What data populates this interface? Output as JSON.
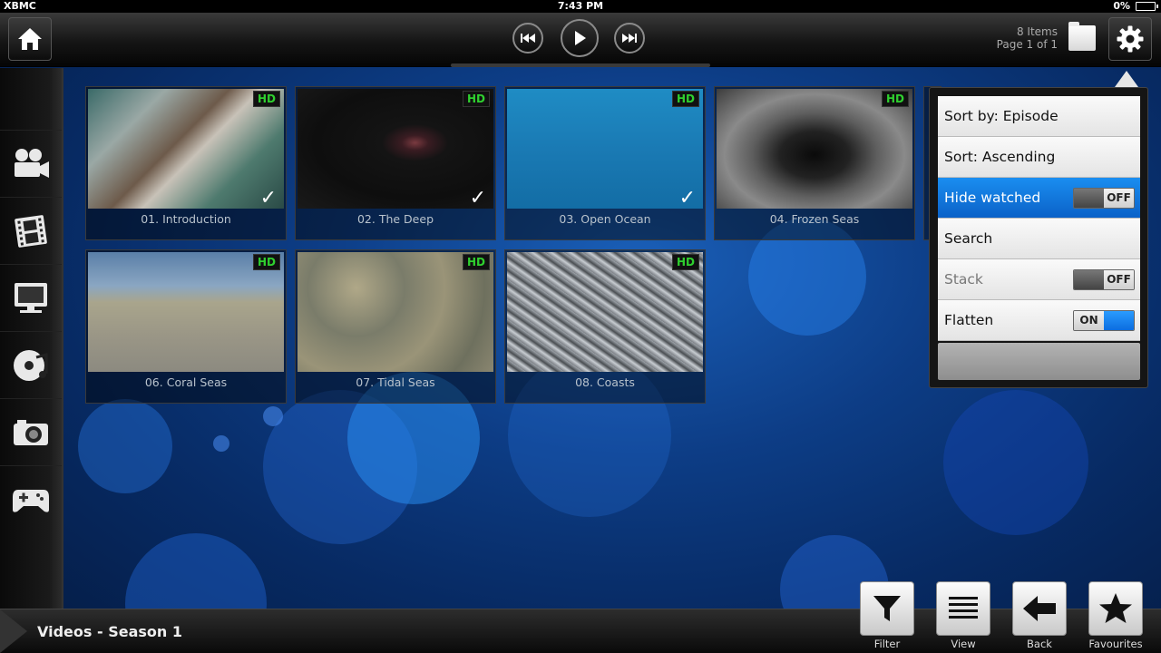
{
  "status_bar": {
    "app_name": "XBMC",
    "time": "7:43 PM",
    "battery": "0%"
  },
  "header": {
    "items_count": "8 Items",
    "page_info": "Page 1 of 1"
  },
  "sidebar": {
    "items": [
      {
        "name": "movies",
        "icon": "film-camera-icon"
      },
      {
        "name": "tv-shows",
        "icon": "film-strip-icon"
      },
      {
        "name": "live-tv",
        "icon": "tv-icon"
      },
      {
        "name": "music",
        "icon": "music-disc-icon"
      },
      {
        "name": "pictures",
        "icon": "camera-icon"
      },
      {
        "name": "games",
        "icon": "gamepad-icon"
      }
    ]
  },
  "episodes": [
    {
      "title": "01. Introduction",
      "badge": "HD",
      "watched": true,
      "check": "✓"
    },
    {
      "title": "02. The Deep",
      "badge": "HD",
      "watched": true,
      "check": "✓"
    },
    {
      "title": "03. Open Ocean",
      "badge": "HD",
      "watched": true,
      "check": "✓"
    },
    {
      "title": "04. Frozen Seas",
      "badge": "HD",
      "watched": false,
      "check": ""
    },
    {
      "title": "",
      "badge": "",
      "watched": false,
      "check": ""
    },
    {
      "title": "06. Coral Seas",
      "badge": "HD",
      "watched": false,
      "check": ""
    },
    {
      "title": "07. Tidal Seas",
      "badge": "HD",
      "watched": false,
      "check": ""
    },
    {
      "title": "08. Coasts",
      "badge": "HD",
      "watched": false,
      "check": ""
    }
  ],
  "options_menu": {
    "sort_by": "Sort by: Episode",
    "sort_order": "Sort: Ascending",
    "hide_watched": {
      "label": "Hide watched",
      "state": "OFF"
    },
    "search": "Search",
    "stack": {
      "label": "Stack",
      "state": "OFF"
    },
    "flatten": {
      "label": "Flatten",
      "state": "ON"
    }
  },
  "breadcrumb": "Videos - Season 1",
  "bottom_buttons": {
    "filter": "Filter",
    "view": "View",
    "back": "Back",
    "favourites": "Favourites"
  },
  "colors": {
    "accent": "#0b72d8",
    "hd_badge": "#2fd02f"
  }
}
